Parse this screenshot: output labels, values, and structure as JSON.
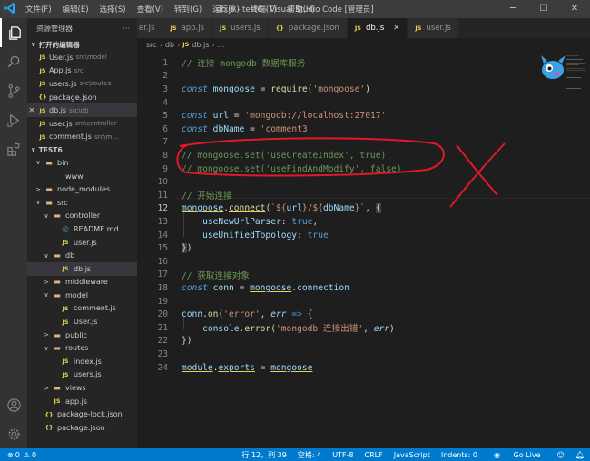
{
  "window": {
    "title": "db.js - test6 - Visual Studio Code [管理员]",
    "menu": [
      "文件(F)",
      "编辑(E)",
      "选择(S)",
      "查看(V)",
      "转到(G)",
      "运行(R)",
      "终端(T)",
      "帮助(H)"
    ],
    "controls": [
      "─",
      "☐",
      "✕"
    ]
  },
  "sidebar": {
    "title": "资源管理器",
    "more": "···",
    "open_editors_label": "打开的编辑器",
    "open_editors": [
      {
        "icon": "JS",
        "name": "User.js",
        "path": "src\\model",
        "selected": false
      },
      {
        "icon": "JS",
        "name": "App.js",
        "path": "src",
        "selected": false
      },
      {
        "icon": "JS",
        "name": "users.js",
        "path": "src\\routes",
        "selected": false
      },
      {
        "icon": "{}",
        "name": "package.json",
        "path": "",
        "selected": false
      },
      {
        "icon": "JS",
        "name": "db.js",
        "path": "src\\db",
        "selected": true,
        "close": "✕"
      },
      {
        "icon": "JS",
        "name": "user.js",
        "path": "src\\controller",
        "selected": false
      },
      {
        "icon": "JS",
        "name": "comment.js",
        "path": "src\\m...",
        "selected": false
      }
    ],
    "workspace_label": "TEST6",
    "tree": [
      {
        "depth": 1,
        "chev": "∨",
        "icon": "folder",
        "name": "bin"
      },
      {
        "depth": 2,
        "chev": "",
        "icon": "none",
        "name": "www"
      },
      {
        "depth": 1,
        "chev": ">",
        "icon": "folder",
        "name": "node_modules"
      },
      {
        "depth": 1,
        "chev": "∨",
        "icon": "folder",
        "name": "src"
      },
      {
        "depth": 2,
        "chev": "∨",
        "icon": "folder",
        "name": "controller"
      },
      {
        "depth": 3,
        "chev": "",
        "icon": "md",
        "name": "README.md"
      },
      {
        "depth": 3,
        "chev": "",
        "icon": "js",
        "name": "user.js"
      },
      {
        "depth": 2,
        "chev": "∨",
        "icon": "folder",
        "name": "db"
      },
      {
        "depth": 3,
        "chev": "",
        "icon": "js",
        "name": "db.js",
        "selected": true
      },
      {
        "depth": 2,
        "chev": ">",
        "icon": "folder",
        "name": "middleware"
      },
      {
        "depth": 2,
        "chev": "∨",
        "icon": "folder",
        "name": "model"
      },
      {
        "depth": 3,
        "chev": "",
        "icon": "js",
        "name": "comment.js"
      },
      {
        "depth": 3,
        "chev": "",
        "icon": "js",
        "name": "User.js"
      },
      {
        "depth": 2,
        "chev": ">",
        "icon": "folder",
        "name": "public"
      },
      {
        "depth": 2,
        "chev": "∨",
        "icon": "folder",
        "name": "routes"
      },
      {
        "depth": 3,
        "chev": "",
        "icon": "js",
        "name": "index.js"
      },
      {
        "depth": 3,
        "chev": "",
        "icon": "js",
        "name": "users.js"
      },
      {
        "depth": 2,
        "chev": ">",
        "icon": "folder",
        "name": "views"
      },
      {
        "depth": 2,
        "chev": "",
        "icon": "js",
        "name": "app.js"
      },
      {
        "depth": 1,
        "chev": "",
        "icon": "json",
        "name": "package-lock.json"
      },
      {
        "depth": 1,
        "chev": "",
        "icon": "json",
        "name": "package.json"
      }
    ]
  },
  "tabs": [
    {
      "icon": "",
      "label": "er.js",
      "active": false
    },
    {
      "icon": "JS",
      "label": "app.js",
      "active": false
    },
    {
      "icon": "JS",
      "label": "users.js",
      "active": false
    },
    {
      "icon": "{}",
      "label": "package.json",
      "active": false
    },
    {
      "icon": "JS",
      "label": "db.js",
      "active": true,
      "close": "✕"
    },
    {
      "icon": "JS",
      "label": "user.js",
      "active": false
    }
  ],
  "breadcrumb": [
    "src",
    "db",
    "db.js",
    "..."
  ],
  "editor": {
    "current_line": 12,
    "lines": [
      {
        "n": 1,
        "html": "<span class='t-c'>// 连接 mongodb 数据库服务</span>"
      },
      {
        "n": 2,
        "html": ""
      },
      {
        "n": 3,
        "html": "<span class='t-k'>const</span> <span class='t-v ul'>mongoose</span> <span class='t-op'>=</span> <span class='t-f ul'>require</span><span class='t-p'>(</span><span class='t-s'>'mongoose'</span><span class='t-p'>)</span>"
      },
      {
        "n": 4,
        "html": ""
      },
      {
        "n": 5,
        "html": "<span class='t-k'>const</span> <span class='t-v'>url</span> <span class='t-op'>=</span> <span class='t-s'>'mongodb://localhost:27017'</span>"
      },
      {
        "n": 6,
        "html": "<span class='t-k'>const</span> <span class='t-v'>dbName</span> <span class='t-op'>=</span> <span class='t-s'>'comment3'</span>"
      },
      {
        "n": 7,
        "html": ""
      },
      {
        "n": 8,
        "html": "<span class='t-c'>// mongoose.set('useCreateIndex', true)</span>"
      },
      {
        "n": 9,
        "html": "<span class='t-c'>// mongoose.set('useFindAndModify', false)</span>"
      },
      {
        "n": 10,
        "html": ""
      },
      {
        "n": 11,
        "html": "<span class='t-c'>// 开始连接</span>"
      },
      {
        "n": 12,
        "html": "<span class='t-v ul'>mongoose</span><span class='t-p'>.</span><span class='t-f ul'>connect</span><span class='t-p'>(</span><span class='t-s'>`${</span><span class='t-v'>url</span><span class='t-s'>}/${</span><span class='t-v'>dbName</span><span class='t-s'>}`</span><span class='t-p'>, </span><span class='t-p bg-hl'>{</span>"
      },
      {
        "n": 13,
        "html": "    <span class='t-v'>useNewUrlParser</span><span class='t-p'>: </span><span class='t-kw2'>true</span><span class='t-p'>,</span>"
      },
      {
        "n": 14,
        "html": "    <span class='t-v'>useUnifiedTopology</span><span class='t-p'>: </span><span class='t-kw2'>true</span>"
      },
      {
        "n": 15,
        "html": "<span class='t-p bg-hl'>}</span><span class='t-p'>)</span>"
      },
      {
        "n": 16,
        "html": ""
      },
      {
        "n": 17,
        "html": "<span class='t-c'>// 获取连接对象</span>"
      },
      {
        "n": 18,
        "html": "<span class='t-k'>const</span> <span class='t-v'>conn</span> <span class='t-op'>=</span> <span class='t-v ul'>mongoose</span><span class='t-p'>.</span><span class='t-v'>connection</span>"
      },
      {
        "n": 19,
        "html": ""
      },
      {
        "n": 20,
        "html": "<span class='t-v'>conn</span><span class='t-p'>.</span><span class='t-f'>on</span><span class='t-p'>(</span><span class='t-s'>'error'</span><span class='t-p'>, </span><span class='t-param'>err</span> <span class='t-kw2'>=&gt;</span> <span class='t-p'>{</span>"
      },
      {
        "n": 21,
        "html": "    <span class='t-v'>console</span><span class='t-p'>.</span><span class='t-f'>error</span><span class='t-p'>(</span><span class='t-s'>'mongodb 连接出错'</span><span class='t-p'>, </span><span class='t-param'>err</span><span class='t-p'>)</span>"
      },
      {
        "n": 22,
        "html": "<span class='t-p'>})</span>"
      },
      {
        "n": 23,
        "html": ""
      },
      {
        "n": 24,
        "html": "<span class='t-v ul'>module</span><span class='t-p'>.</span><span class='t-v ul'>exports</span> <span class='t-op'>=</span> <span class='t-v ul'>mongoose</span>"
      }
    ]
  },
  "status": {
    "errors": "0",
    "warnings": "0",
    "position": "行 12，列 39",
    "spaces": "空格: 4",
    "encoding": "UTF-8",
    "eol": "CRLF",
    "language": "JavaScript",
    "indents": "Indents: 0",
    "golive": "Go Live"
  },
  "colors": {
    "accent": "#007acc",
    "annotation": "#e0192a"
  }
}
